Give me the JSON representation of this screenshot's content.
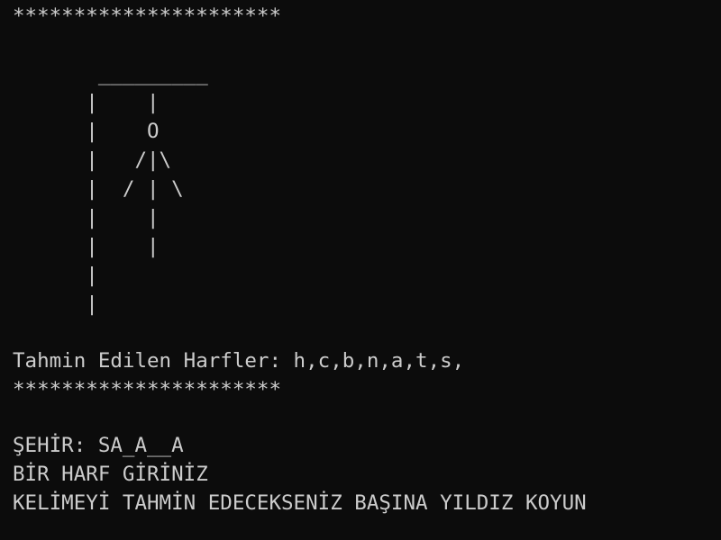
{
  "terminal": {
    "separator_top": "**********************",
    "hangman": [
      "       _________",
      "      |    |",
      "      |    O",
      "      |   /|\\",
      "      |  / | \\",
      "      |    |",
      "      |    |",
      "      |",
      "      |"
    ],
    "guessed_letters": "Tahmin Edilen Harfler: h,c,b,n,a,t,s,",
    "separator_bottom": "**********************",
    "city_line": "ŞEHİR: SA_A__A",
    "prompt_letter": "BİR HARF GİRİNİZ",
    "prompt_word": "KELİMEYİ TAHMİN EDECEKSENİZ BAŞINA YILDIZ KOYUN"
  }
}
